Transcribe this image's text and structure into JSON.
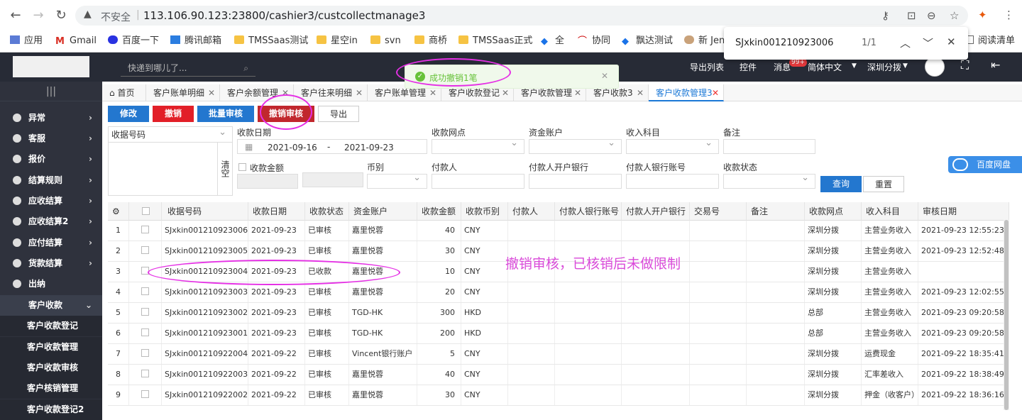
{
  "browser": {
    "insecure_label": "不安全",
    "url": "113.106.90.123:23800/cashier3/custcollectmanage3",
    "bookmarks": [
      "应用",
      "Gmail",
      "百度一下",
      "腾讯邮箱",
      "TMSSaas测试",
      "星空in",
      "svn",
      "商桥",
      "TMSSaas正式",
      "全",
      "协同",
      "飘达测试",
      "新 Jen",
      "阅读清单"
    ]
  },
  "findbar": {
    "query": "SJxkin001210923006",
    "count": "1/1"
  },
  "header": {
    "search_placeholder": "快递到哪儿了...",
    "export_list": "导出列表",
    "controls": "控件",
    "messages": "消息",
    "messages_badge": "99+",
    "language": "简体中文",
    "branch": "深圳分拨"
  },
  "toast": {
    "message": "成功撤销1笔"
  },
  "sidebar": {
    "items": [
      {
        "label": "异常"
      },
      {
        "label": "客服"
      },
      {
        "label": "报价"
      },
      {
        "label": "结算规则"
      },
      {
        "label": "应收结算"
      },
      {
        "label": "应收结算2"
      },
      {
        "label": "应付结算"
      },
      {
        "label": "货款结算"
      },
      {
        "label": "出纳"
      },
      {
        "label": "客户收款"
      }
    ],
    "subitems": [
      "客户收款登记",
      "客户收款管理",
      "客户收款审核",
      "客户核销管理",
      "客户收款登记2"
    ]
  },
  "tabs": [
    {
      "label": "首页"
    },
    {
      "label": "客户账单明细"
    },
    {
      "label": "客户余额管理"
    },
    {
      "label": "客户往来明细"
    },
    {
      "label": "客户账单管理"
    },
    {
      "label": "客户收款登记"
    },
    {
      "label": "客户收款管理"
    },
    {
      "label": "客户收款3"
    },
    {
      "label": "客户收款管理3"
    }
  ],
  "toolbar": {
    "edit": "修改",
    "revoke": "撤销",
    "batch_review": "批量审核",
    "revoke_review": "撤销审核",
    "export": "导出"
  },
  "filters": {
    "receipt_no": "收据号码",
    "clear": "清空",
    "date_label": "收款日期",
    "date_from": "2021-09-16",
    "date_sep": "-",
    "date_to": "2021-09-23",
    "branch_label": "收款网点",
    "account_label": "资金账户",
    "subject_label": "收入科目",
    "remark_label": "备注",
    "amount_label": "收款金额",
    "currency_label": "币别",
    "payer_label": "付款人",
    "payer_bank_label": "付款人开户银行",
    "payer_account_label": "付款人银行账号",
    "status_label": "收款状态",
    "query": "查询",
    "reset": "重置"
  },
  "baidu_widget": "百度网盘",
  "table": {
    "columns": [
      "",
      "",
      "收据号码",
      "收款日期",
      "收款状态",
      "资金账户",
      "收款金额",
      "收款币别",
      "付款人",
      "付款人银行账号",
      "付款人开户银行",
      "交易号",
      "备注",
      "收款网点",
      "收入科目",
      "审核日期"
    ],
    "rows": [
      [
        "1",
        "SJxkin001210923006",
        "2021-09-23",
        "已审核",
        "嘉里悦蓉",
        "40",
        "CNY",
        "深圳分拨",
        "主营业务收入",
        "2021-09-23 12:55:23"
      ],
      [
        "2",
        "SJxkin001210923005",
        "2021-09-23",
        "已审核",
        "嘉里悦蓉",
        "30",
        "CNY",
        "深圳分拨",
        "主营业务收入",
        "2021-09-23 12:52:48"
      ],
      [
        "3",
        "SJxkin001210923004",
        "2021-09-23",
        "已收款",
        "嘉里悦蓉",
        "10",
        "CNY",
        "深圳分拨",
        "主营业务收入",
        ""
      ],
      [
        "4",
        "SJxkin001210923003",
        "2021-09-23",
        "已审核",
        "嘉里悦蓉",
        "20",
        "CNY",
        "深圳分拨",
        "主营业务收入",
        "2021-09-23 12:02:55"
      ],
      [
        "5",
        "SJxkin001210923002",
        "2021-09-23",
        "已审核",
        "TGD-HK",
        "300",
        "HKD",
        "总部",
        "主营业务收入",
        "2021-09-23 09:20:58"
      ],
      [
        "6",
        "SJxkin001210923001",
        "2021-09-23",
        "已审核",
        "TGD-HK",
        "200",
        "HKD",
        "总部",
        "主营业务收入",
        "2021-09-23 09:20:58"
      ],
      [
        "7",
        "SJxkin001210922004",
        "2021-09-22",
        "已审核",
        "Vincent银行账户",
        "5",
        "CNY",
        "深圳分拨",
        "运费现金",
        "2021-09-22 18:35:41"
      ],
      [
        "8",
        "SJxkin001210922003",
        "2021-09-22",
        "已审核",
        "嘉里悦蓉",
        "40",
        "CNY",
        "深圳分拨",
        "汇率差收入",
        "2021-09-22 18:38:49"
      ],
      [
        "9",
        "SJxkin001210922002",
        "2021-09-22",
        "已审核",
        "嘉里悦蓉",
        "30",
        "CNY",
        "深圳分拨",
        "押金（收客户）",
        "2021-09-22 18:36:16"
      ]
    ]
  },
  "annotation": "撤销审核，已核销后未做限制"
}
